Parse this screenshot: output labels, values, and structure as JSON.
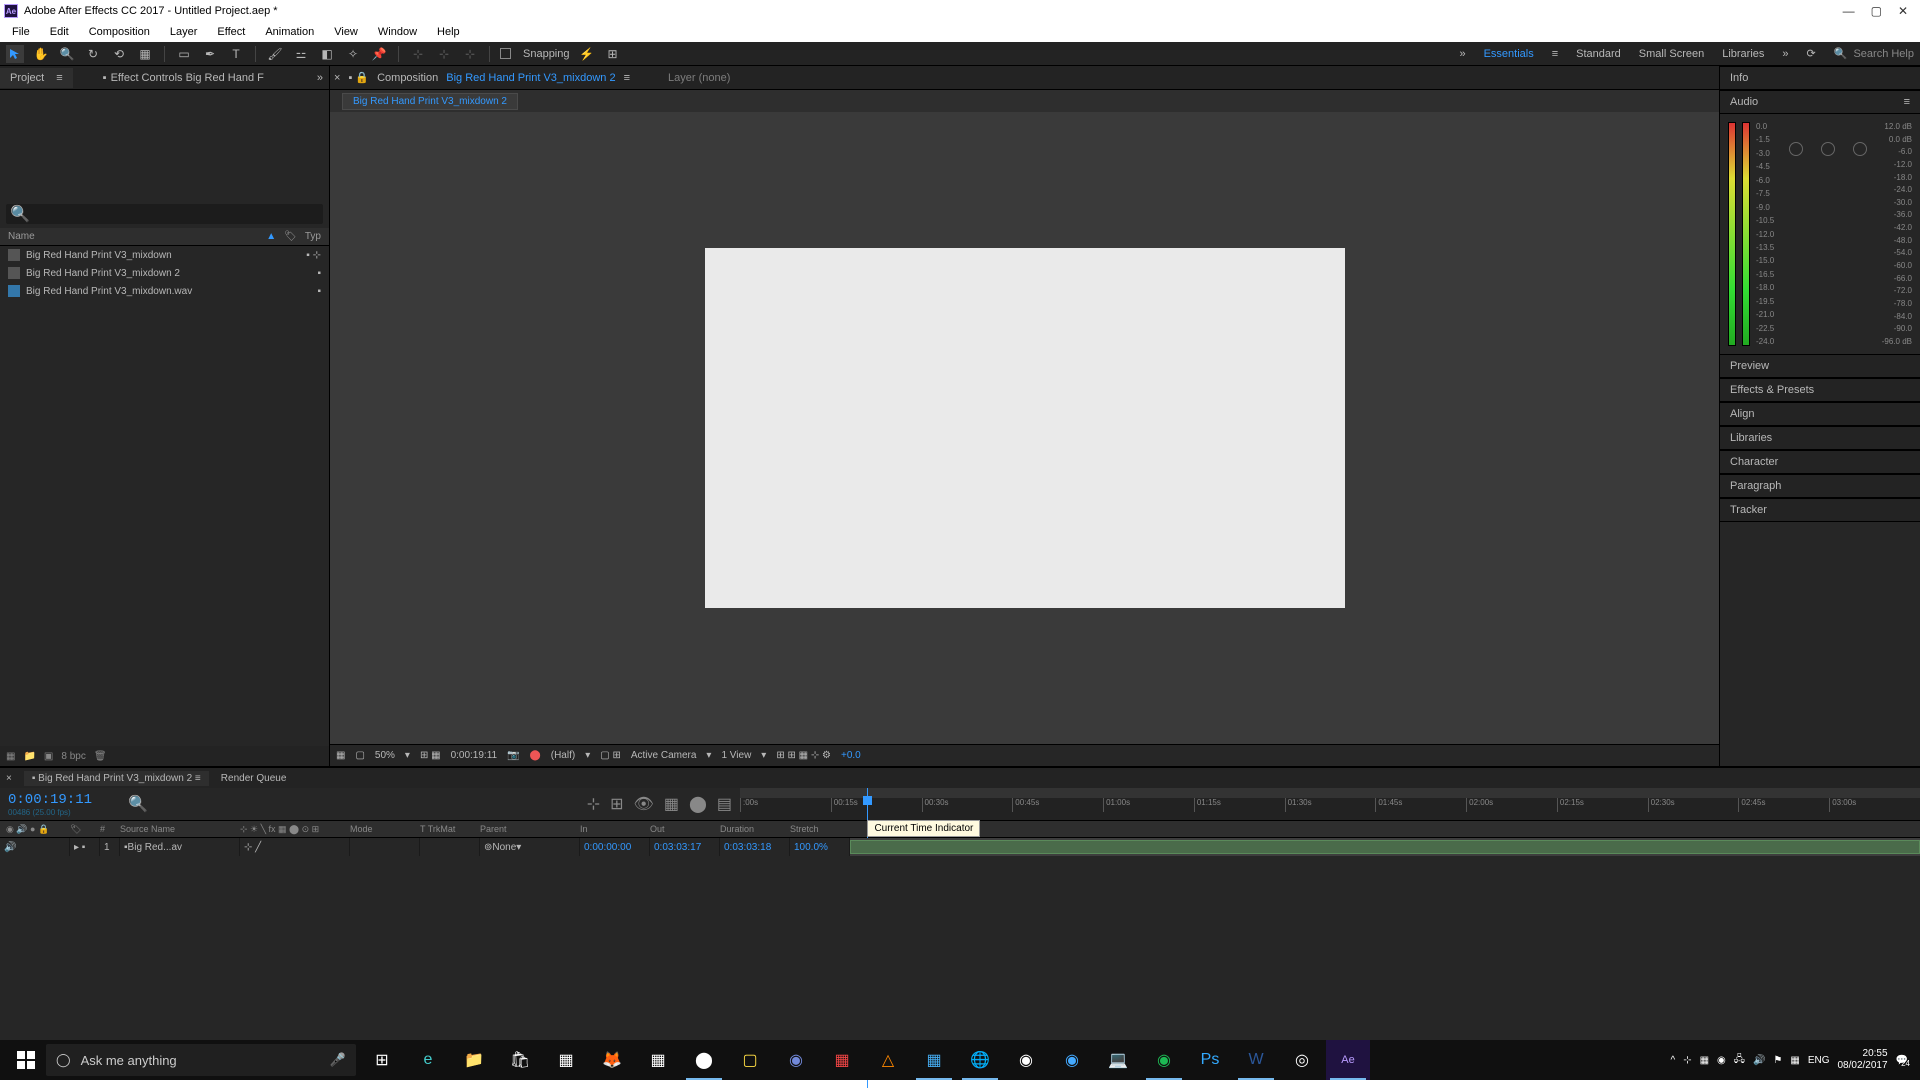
{
  "window": {
    "title": "Adobe After Effects CC 2017 - Untitled Project.aep *",
    "minimize": "—",
    "maximize": "▢",
    "close": "✕"
  },
  "menu": [
    "File",
    "Edit",
    "Composition",
    "Layer",
    "Effect",
    "Animation",
    "View",
    "Window",
    "Help"
  ],
  "toolbar": {
    "snapping": "Snapping",
    "workspaces": [
      "Essentials",
      "Standard",
      "Small Screen",
      "Libraries"
    ],
    "search_placeholder": "Search Help"
  },
  "project_panel": {
    "tab_project": "Project",
    "tab_effect_controls": "Effect Controls Big Red Hand F",
    "col_name": "Name",
    "col_type": "Typ",
    "items": [
      "Big Red Hand Print V3_mixdown",
      "Big Red Hand Print V3_mixdown 2",
      "Big Red Hand Print V3_mixdown.wav"
    ],
    "bpc": "8 bpc"
  },
  "comp_panel": {
    "prefix": "Composition",
    "name": "Big Red Hand Print V3_mixdown 2",
    "layer_tab": "Layer (none)",
    "crumb": "Big Red Hand Print V3_mixdown 2",
    "footer": {
      "zoom": "50%",
      "time": "0:00:19:11",
      "res": "(Half)",
      "camera": "Active Camera",
      "view": "1 View",
      "exposure": "+0.0"
    }
  },
  "right_panels": {
    "info": "Info",
    "audio": "Audio",
    "db_left": [
      "0.0",
      "-1.5",
      "-3.0",
      "-4.5",
      "-6.0",
      "-7.5",
      "-9.0",
      "-10.5",
      "-12.0",
      "-13.5",
      "-15.0",
      "-16.5",
      "-18.0",
      "-19.5",
      "-21.0",
      "-22.5",
      "-24.0"
    ],
    "db_right": [
      "12.0 dB",
      "0.0 dB",
      "-6.0",
      "-12.0",
      "-18.0",
      "-24.0",
      "-30.0",
      "-36.0",
      "-42.0",
      "-48.0",
      "-54.0",
      "-60.0",
      "-66.0",
      "-72.0",
      "-78.0",
      "-84.0",
      "-90.0",
      "-96.0 dB"
    ],
    "preview": "Preview",
    "effects": "Effects & Presets",
    "align": "Align",
    "libraries": "Libraries",
    "character": "Character",
    "paragraph": "Paragraph",
    "tracker": "Tracker"
  },
  "timeline": {
    "tab_comp": "Big Red Hand Print V3_mixdown 2",
    "tab_render": "Render Queue",
    "current_time": "0:00:19:11",
    "frames": "00486 (25.00 fps)",
    "cols": {
      "num": "#",
      "source": "Source Name",
      "mode": "Mode",
      "trkmat": "TrkMat",
      "parent": "Parent",
      "in": "In",
      "out": "Out",
      "duration": "Duration",
      "stretch": "Stretch"
    },
    "layer": {
      "num": "1",
      "name": "Big Red...av",
      "parent": "None",
      "in": "0:00:00:00",
      "out": "0:03:03:17",
      "duration": "0:03:03:18",
      "stretch": "100.0%"
    },
    "ticks": [
      ":00s",
      "00:15s",
      "00:30s",
      "00:45s",
      "01:00s",
      "01:15s",
      "01:30s",
      "01:45s",
      "02:00s",
      "02:15s",
      "02:30s",
      "02:45s",
      "03:00s"
    ],
    "tooltip": "Current Time Indicator"
  },
  "taskbar": {
    "search": "Ask me anything",
    "lang": "ENG",
    "time": "20:55",
    "date": "08/02/2017",
    "notifications": "24"
  }
}
